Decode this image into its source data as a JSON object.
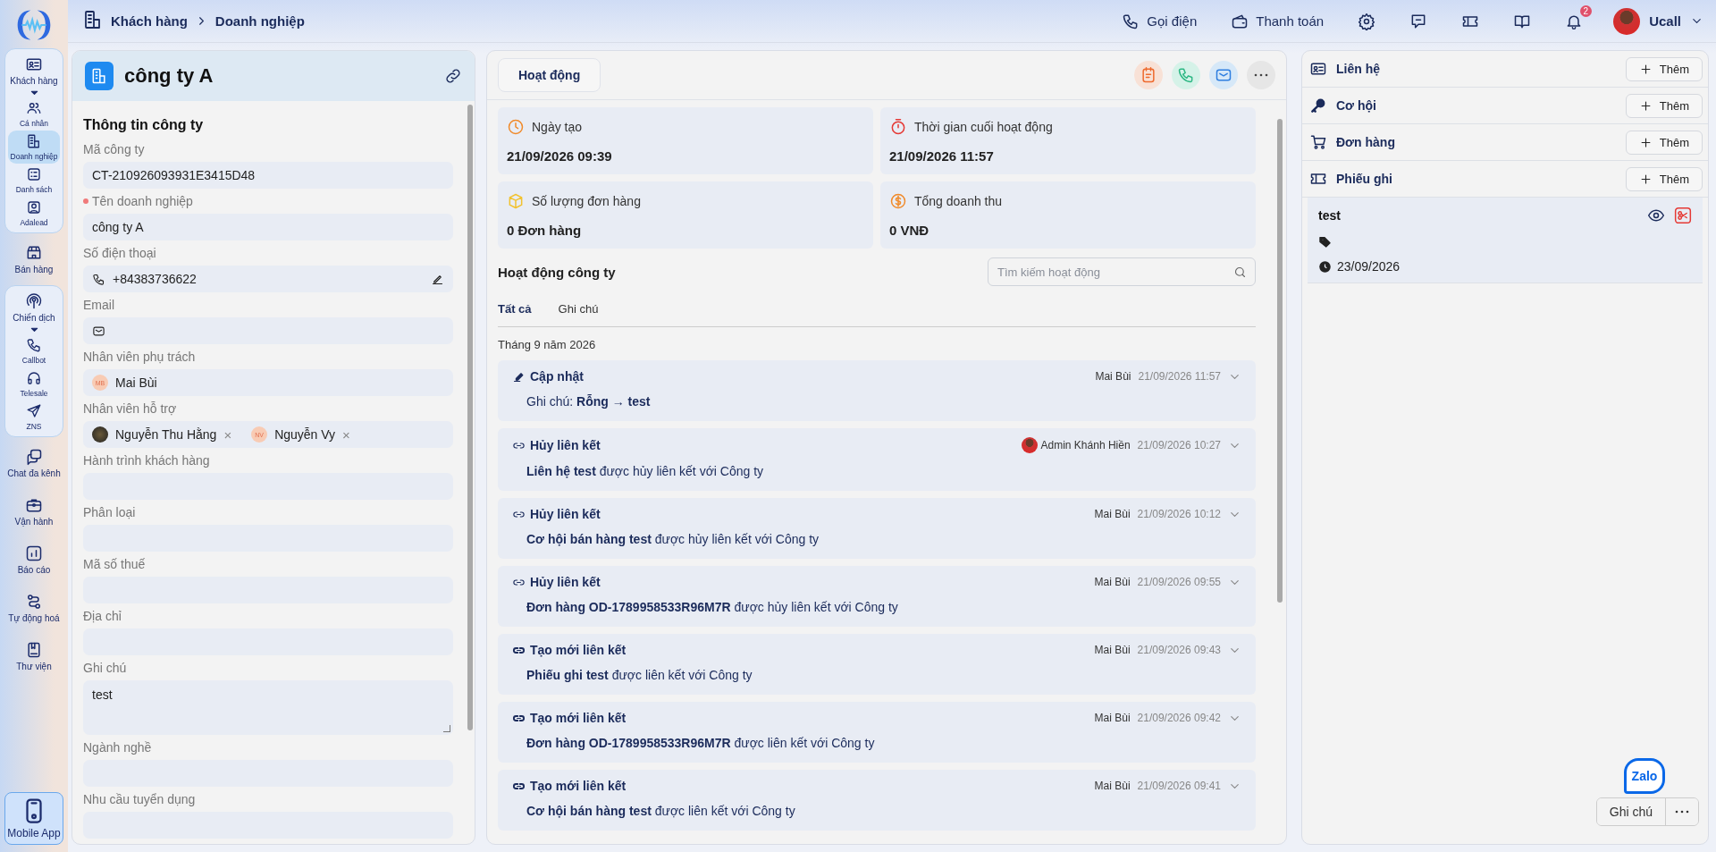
{
  "sidebar": {
    "items": [
      {
        "label": "Khách hàng",
        "expanded": true,
        "children": [
          {
            "label": "Cá nhân",
            "selected": false
          },
          {
            "label": "Doanh nghiệp",
            "selected": true
          },
          {
            "label": "Danh sách",
            "selected": false
          },
          {
            "label": "Adalead",
            "selected": false
          }
        ]
      },
      {
        "label": "Bán hàng"
      },
      {
        "label": "Chiến dịch",
        "expanded": true,
        "children": [
          {
            "label": "Callbot",
            "selected": false
          },
          {
            "label": "Telesale",
            "selected": false
          },
          {
            "label": "ZNS",
            "selected": false
          }
        ]
      },
      {
        "label": "Chat đa kênh"
      },
      {
        "label": "Vận hành"
      },
      {
        "label": "Báo cáo"
      },
      {
        "label": "Tự động hoá"
      },
      {
        "label": "Thư viện"
      },
      {
        "label": "Mobile App",
        "kind": "app"
      }
    ]
  },
  "breadcrumb": [
    "Khách hàng",
    "Doanh nghiệp"
  ],
  "topbar": {
    "actions": [
      "Gọi điện",
      "Thanh toán"
    ],
    "notification_count": "2",
    "user": "Ucall"
  },
  "company": {
    "name": "công ty A",
    "section_title": "Thông tin công ty",
    "fields": [
      {
        "label": "Mã công ty",
        "kind": "text",
        "value": "CT-210926093931E3415D48"
      },
      {
        "label": "Tên doanh nghiệp",
        "kind": "text",
        "value": "công ty A",
        "required": true
      },
      {
        "label": "Số điện thoại",
        "kind": "phone",
        "value": "+84383736622"
      },
      {
        "label": "Email",
        "kind": "email"
      },
      {
        "label": "Nhân viên phụ trách",
        "kind": "people",
        "people": [
          {
            "name": "Mai Bùi",
            "initials": "MB"
          }
        ]
      },
      {
        "label": "Nhân viên hỗ trợ",
        "kind": "people",
        "people": [
          {
            "name": "Nguyễn Thu Hằng",
            "photo": true,
            "remove": "×"
          },
          {
            "name": "Nguyễn Vy",
            "initials": "NV",
            "remove": "×"
          }
        ]
      },
      {
        "label": "Hành trình khách hàng",
        "kind": "text"
      },
      {
        "label": "Phân loại",
        "kind": "text"
      },
      {
        "label": "Mã số thuế",
        "kind": "text"
      },
      {
        "label": "Địa chỉ",
        "kind": "text"
      },
      {
        "label": "Ghi chú",
        "kind": "textarea",
        "value": "test"
      },
      {
        "label": "Ngành nghề",
        "kind": "text"
      },
      {
        "label": "Nhu cầu tuyển dụng",
        "kind": "text"
      }
    ]
  },
  "activity": {
    "tab": "Hoạt động",
    "stats": [
      {
        "kind": "created",
        "label": "Ngày tạo",
        "value": "21/09/2026 09:39"
      },
      {
        "kind": "last",
        "label": "Thời gian cuối hoạt động",
        "value": "21/09/2026 11:57"
      },
      {
        "kind": "orders",
        "label": "Số lượng đơn hàng",
        "value": "0 Đơn hàng"
      },
      {
        "kind": "revenue",
        "label": "Tổng doanh thu",
        "value": "0 VNĐ"
      }
    ],
    "title": "Hoạt động công ty",
    "search": {
      "placeholder": "Tìm kiếm hoạt động"
    },
    "filters": [
      {
        "label": "Tất cả",
        "selected": true
      },
      {
        "label": "Ghi chú",
        "selected": false
      }
    ],
    "month": "Tháng 9 năm 2026",
    "entries": [
      {
        "kind": "update",
        "title": "Cập nhật",
        "user": "Mai Bùi",
        "time": "21/09/2026 11:57",
        "text": "Ghi chú: **Rỗng → test**"
      },
      {
        "kind": "unlink",
        "title": "Hủy liên kết",
        "user": "Admin Khánh Hiền",
        "user_photo": true,
        "time": "21/09/2026 10:27",
        "text": "**Liên hệ test** được hủy liên kết với Công ty"
      },
      {
        "kind": "unlink",
        "title": "Hủy liên kết",
        "user": "Mai Bùi",
        "time": "21/09/2026 10:12",
        "text": "**Cơ hội bán hàng test** được hủy liên kết với Công ty"
      },
      {
        "kind": "unlink",
        "title": "Hủy liên kết",
        "user": "Mai Bùi",
        "time": "21/09/2026 09:55",
        "text": "**Đơn hàng OD-1789958533R96M7R** được hủy liên kết với Công ty"
      },
      {
        "kind": "link",
        "title": "Tạo mới liên kết",
        "user": "Mai Bùi",
        "time": "21/09/2026 09:43",
        "text": "**Phiếu ghi test** được liên kết với Công ty"
      },
      {
        "kind": "link",
        "title": "Tạo mới liên kết",
        "user": "Mai Bùi",
        "time": "21/09/2026 09:42",
        "text": "**Đơn hàng OD-1789958533R96M7R** được liên kết với Công ty"
      },
      {
        "kind": "link",
        "title": "Tạo mới liên kết",
        "user": "Mai Bùi",
        "time": "21/09/2026 09:41",
        "text": "**Cơ hội bán hàng test** được liên kết với Công ty"
      }
    ]
  },
  "related": {
    "sections": [
      {
        "kind": "contact",
        "title": "Liên hệ",
        "button": "Thêm"
      },
      {
        "kind": "deal",
        "title": "Cơ hội",
        "button": "Thêm"
      },
      {
        "kind": "order",
        "title": "Đơn hàng",
        "button": "Thêm"
      },
      {
        "kind": "ticket",
        "title": "Phiếu ghi",
        "button": "Thêm",
        "records": [
          {
            "title": "test",
            "date": "23/09/2026"
          }
        ]
      }
    ],
    "footer_button": "Ghi chú",
    "chat_bubble": "Zalo"
  }
}
